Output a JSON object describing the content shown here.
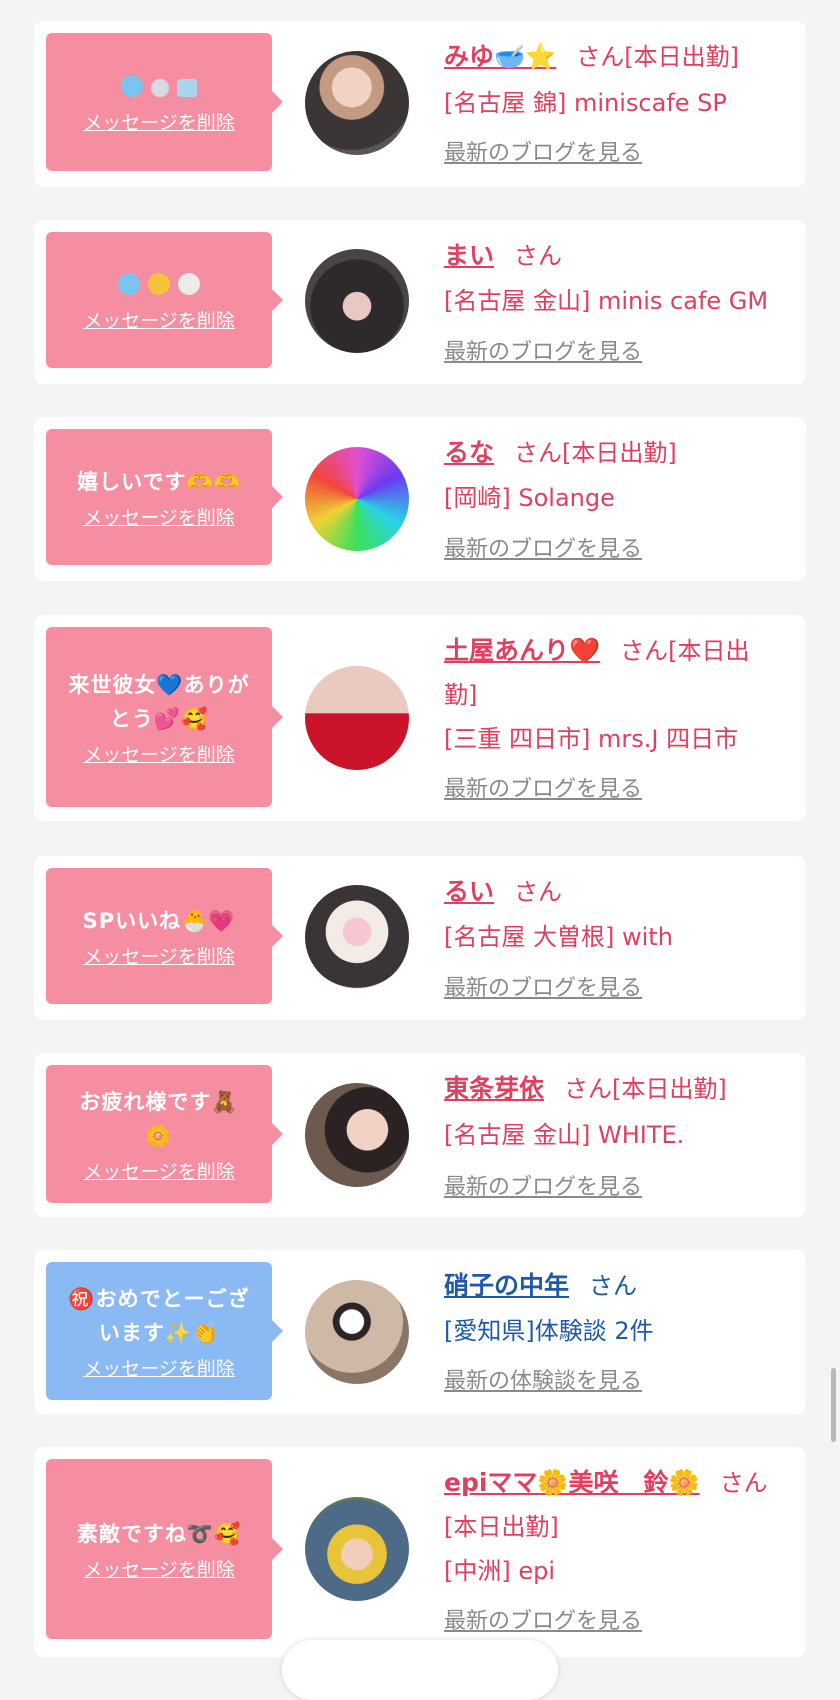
{
  "cards": [
    {
      "msg": "",
      "delete": "メッセージを削除",
      "name": "みゆ🥣⭐",
      "san": "さん",
      "attend": "[本日出勤]",
      "area": "[名古屋 錦] miniscafe SP",
      "link": "最新のブログを見る"
    },
    {
      "msg": "",
      "delete": "メッセージを削除",
      "name": "まい",
      "san": "さん",
      "attend": "",
      "area": "[名古屋 金山] minis cafe GM",
      "link": "最新のブログを見る"
    },
    {
      "msg": "嬉しいです🫶🫶",
      "delete": "メッセージを削除",
      "name": "るな",
      "san": "さん",
      "attend": "[本日出勤]",
      "area": "[岡崎] Solange",
      "link": "最新のブログを見る"
    },
    {
      "msg1": "来世彼女💙ありが",
      "msg2": "とう💕🥰",
      "delete": "メッセージを削除",
      "name": "土屋あんり❤️",
      "san": "さん",
      "attend1": "[本日出",
      "attend2": "勤]",
      "area": "[三重 四日市] mrs.J 四日市",
      "link": "最新のブログを見る"
    },
    {
      "msg": "SPいいね🐣💗",
      "delete": "メッセージを削除",
      "name": "るい",
      "san": "さん",
      "attend": "",
      "area": "[名古屋 大曽根] with",
      "link": "最新のブログを見る"
    },
    {
      "msg1": "お疲れ様です🧸",
      "msg2": "🌼",
      "delete": "メッセージを削除",
      "name": "東条芽依",
      "san": "さん",
      "attend": "[本日出勤]",
      "area": "[名古屋 金山] WHITE.",
      "link": "最新のブログを見る"
    },
    {
      "msg1": "㊗️おめでとーござ",
      "msg2": "います✨👏",
      "delete": "メッセージを削除",
      "name": "硝子の中年",
      "san": "さん",
      "attend": "",
      "area": "[愛知県]体験談 2件",
      "link": "最新の体験談を見る"
    },
    {
      "msg": "素敵ですね➰🥰",
      "delete": "メッセージを削除",
      "name": "epiママ🌼美咲　鈴🌼",
      "san": "さん",
      "attend": "[本日出勤]",
      "area": "[中洲] epi",
      "link": "最新のブログを見る"
    }
  ],
  "colors": {
    "accent_pink": "#e0405f",
    "bubble_pink": "#f58ea0",
    "bubble_blue": "#8bb9f4",
    "name_blue": "#1f5aa8"
  }
}
